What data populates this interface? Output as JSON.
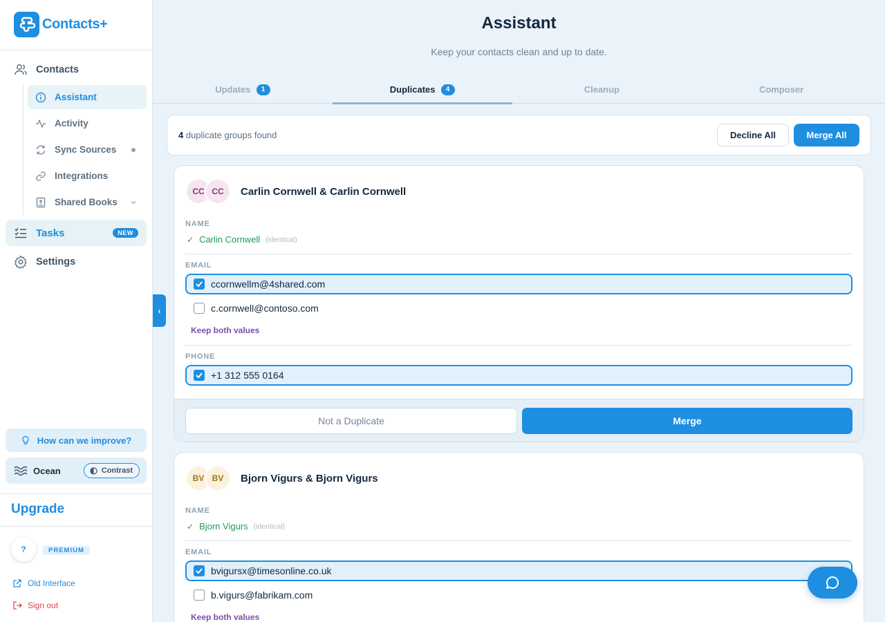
{
  "app": {
    "name": "Contacts+"
  },
  "sidebar": {
    "contacts_label": "Contacts",
    "sub_items": [
      {
        "label": "Assistant",
        "icon": "info-circle-icon"
      },
      {
        "label": "Activity",
        "icon": "activity-icon"
      },
      {
        "label": "Sync Sources",
        "icon": "sync-icon"
      },
      {
        "label": "Integrations",
        "icon": "link-icon"
      },
      {
        "label": "Shared Books",
        "icon": "book-icon"
      }
    ],
    "tasks_label": "Tasks",
    "tasks_badge": "NEW",
    "settings_label": "Settings",
    "improve_label": "How can we improve?",
    "theme_name": "Ocean",
    "contrast_label": "Contrast",
    "upgrade_label": "Upgrade",
    "avatar_initial": "?",
    "plan_badge": "PREMIUM",
    "old_interface_label": "Old Interface",
    "sign_out_label": "Sign out"
  },
  "header": {
    "title": "Assistant",
    "subtitle": "Keep your contacts clean and up to date."
  },
  "tabs": [
    {
      "label": "Updates",
      "count": "1"
    },
    {
      "label": "Duplicates",
      "count": "4"
    },
    {
      "label": "Cleanup",
      "count": ""
    },
    {
      "label": "Composer",
      "count": ""
    }
  ],
  "summary": {
    "count": "4",
    "text": " duplicate groups found",
    "decline_all": "Decline All",
    "merge_all": "Merge All"
  },
  "groups": [
    {
      "initials_a": "CC",
      "initials_b": "CC",
      "title": "Carlin Cornwell & Carlin Cornwell",
      "name_label": "NAME",
      "name_value": "Carlin Cornwell",
      "identical": "(identical)",
      "email_label": "EMAIL",
      "emails": [
        "ccornwellm@4shared.com",
        "c.cornwell@contoso.com"
      ],
      "keep_both": "Keep both values",
      "phone_label": "PHONE",
      "phones": [
        "+1 312 555 0164"
      ],
      "not_duplicate": "Not a Duplicate",
      "merge": "Merge"
    },
    {
      "initials_a": "BV",
      "initials_b": "BV",
      "title": "Bjorn Vigurs & Bjorn Vigurs",
      "name_label": "NAME",
      "name_value": "Bjorn Vigurs",
      "identical": "(identical)",
      "email_label": "EMAIL",
      "emails": [
        "bvigursx@timesonline.co.uk",
        "b.vigurs@fabrikam.com"
      ],
      "keep_both": "Keep both values"
    }
  ],
  "colors": {
    "accent": "#1e8ee0",
    "success": "#1f9a57",
    "keep_both": "#7d4ea8",
    "danger": "#e0464b"
  }
}
